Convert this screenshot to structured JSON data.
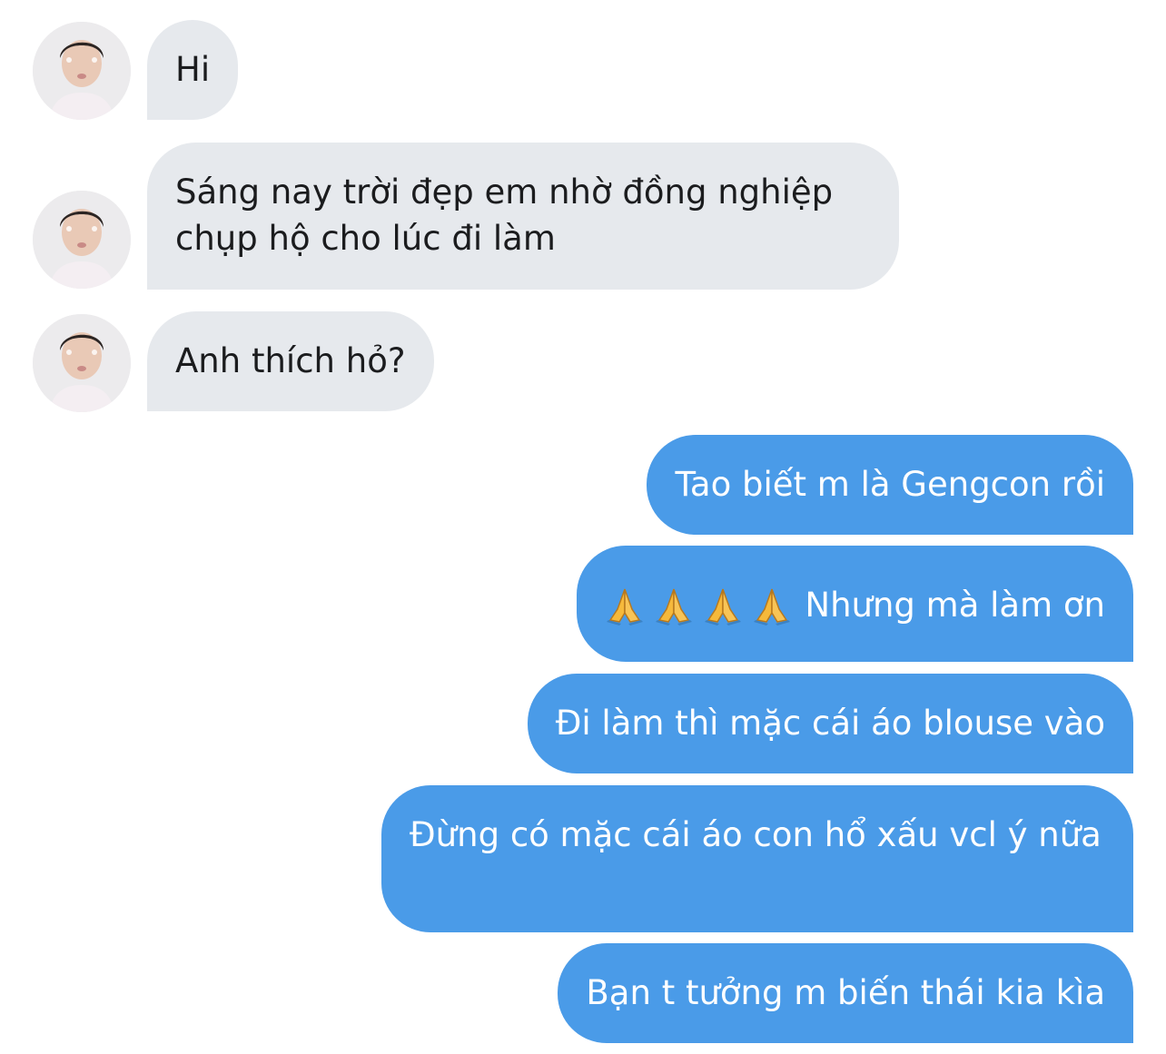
{
  "conversation": {
    "received": [
      {
        "text": "Hi"
      },
      {
        "text": "Sáng nay trời đẹp em nhờ đồng nghiệp chụp hộ cho lúc đi làm"
      },
      {
        "text": "Anh thích hỏ?"
      }
    ],
    "sent": [
      {
        "text": "Tao biết m là Gengcon rồi"
      },
      {
        "emoji": [
          "folded-hands-emoji",
          "folded-hands-emoji",
          "folded-hands-emoji",
          "folded-hands-emoji"
        ],
        "text": "Nhưng mà làm ơn"
      },
      {
        "text": "Đi làm thì mặc cái áo blouse vào"
      },
      {
        "text": "Đừng có mặc cái áo con hổ xấu vcl ý nữa"
      },
      {
        "text": "Bạn t tưởng m biến thái kia kìa"
      }
    ]
  },
  "colors": {
    "received_bubble": "#e6e9ed",
    "sent_bubble": "#4a9be8",
    "received_text": "#1b1c1e",
    "sent_text": "#ffffff"
  }
}
